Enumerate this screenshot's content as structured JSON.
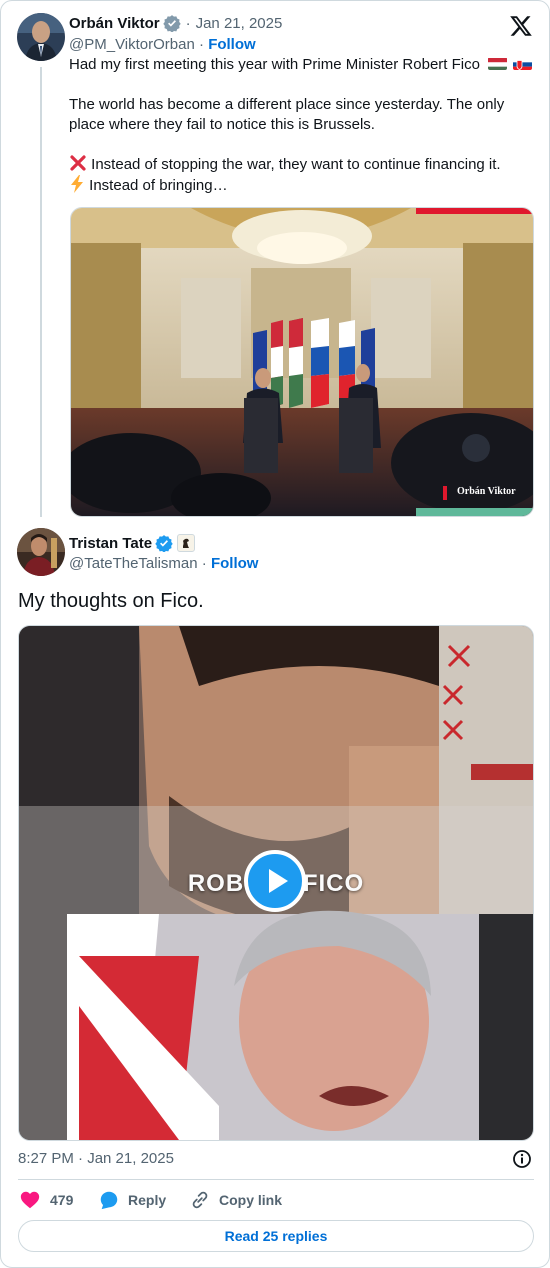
{
  "quoted": {
    "name": "Orbán Viktor",
    "date": "Jan 21, 2025",
    "handle": "@PM_ViktorOrban",
    "follow_label": "Follow",
    "text_line1": "Had my first meeting this year with Prime Minister Robert Fico",
    "text_line2": "The world has become a different place since yesterday. The only place where they fail to notice this is Brussels.",
    "text_line3": "Instead of stopping the war, they want to continue financing it.",
    "text_line4": "Instead of bringing…",
    "image_watermark": "Orbán Viktor"
  },
  "tweet": {
    "name": "Tristan Tate",
    "handle": "@TateTheTalisman",
    "follow_label": "Follow",
    "text": "My thoughts on Fico.",
    "video_caption": "ROBERT FICO",
    "timestamp": "8:27 PM · Jan 21, 2025"
  },
  "actions": {
    "likes": "479",
    "reply_label": "Reply",
    "copy_label": "Copy link"
  },
  "read_replies_label": "Read 25 replies",
  "colors": {
    "accent": "#1d9bf0",
    "link": "#006fd6",
    "like": "#f91880",
    "border": "#cfd9de"
  },
  "icons": [
    "x-logo-icon",
    "verified-badge-icon",
    "gray-verified-badge-icon",
    "play-icon",
    "info-icon",
    "heart-icon",
    "reply-icon",
    "link-icon"
  ]
}
